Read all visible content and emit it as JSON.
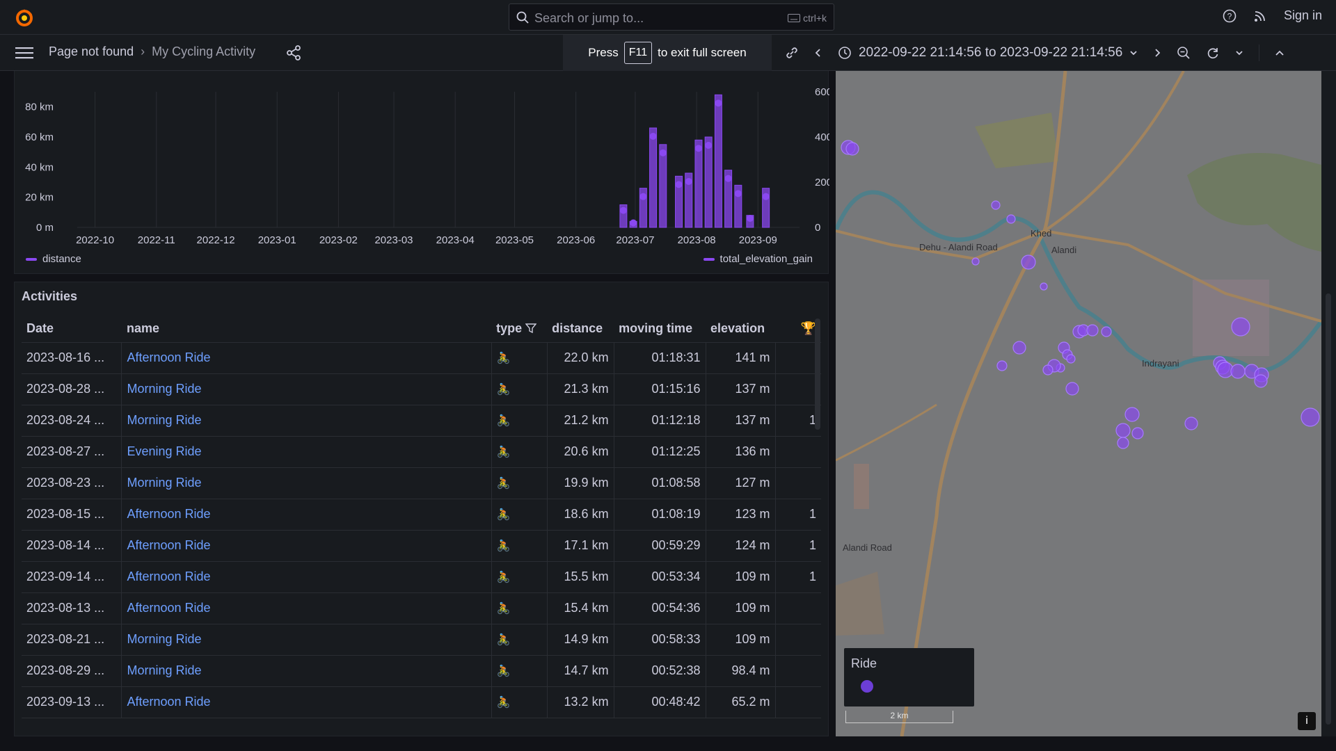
{
  "topbar": {
    "search_placeholder": "Search or jump to...",
    "search_shortcut": "ctrl+k",
    "sign_in": "Sign in"
  },
  "navbar": {
    "breadcrumb": [
      "Page not found",
      "My Cycling Activity"
    ],
    "f11_press": "Press",
    "f11_key": "F11",
    "f11_rest": "to exit full screen",
    "time_range": "2022-09-22 21:14:56 to 2023-09-22 21:14:56"
  },
  "chart_data": {
    "type": "bar",
    "x_ticks": [
      "2022-10",
      "2022-11",
      "2022-12",
      "2023-01",
      "2023-02",
      "2023-03",
      "2023-04",
      "2023-05",
      "2023-06",
      "2023-07",
      "2023-08",
      "2023-09"
    ],
    "y_left_ticks": [
      "0 m",
      "20 km",
      "40 km",
      "60 km",
      "80 km"
    ],
    "y_right_ticks": [
      "0",
      "200",
      "400",
      "600"
    ],
    "ylim_left_km": [
      0,
      90
    ],
    "ylim_right": [
      0,
      600
    ],
    "series": [
      {
        "name": "distance",
        "color": "#8a48f0",
        "dates": [
          "2023-06-25",
          "2023-06-30",
          "2023-07-05",
          "2023-07-10",
          "2023-07-15",
          "2023-07-23",
          "2023-07-28",
          "2023-08-02",
          "2023-08-07",
          "2023-08-12",
          "2023-08-17",
          "2023-08-22",
          "2023-08-28",
          "2023-09-05"
        ],
        "values_km": [
          15,
          4,
          26,
          66,
          55,
          34,
          36,
          58,
          60,
          88,
          38,
          28,
          8,
          26
        ]
      },
      {
        "name": "total_elevation_gain",
        "color": "#8a48f0"
      }
    ],
    "legend_left": "distance",
    "legend_right": "total_elevation_gain"
  },
  "activities": {
    "title": "Activities",
    "columns": [
      "Date",
      "name",
      "type",
      "distance",
      "moving time",
      "elevation",
      ""
    ],
    "rows": [
      {
        "date": "2023-08-16 ...",
        "name": "Afternoon Ride",
        "type": "🚴",
        "distance": "22.0 km",
        "moving": "01:18:31",
        "elev": "141 m",
        "trophy": ""
      },
      {
        "date": "2023-08-28 ...",
        "name": "Morning Ride",
        "type": "🚴",
        "distance": "21.3 km",
        "moving": "01:15:16",
        "elev": "137 m",
        "trophy": ""
      },
      {
        "date": "2023-08-24 ...",
        "name": "Morning Ride",
        "type": "🚴",
        "distance": "21.2 km",
        "moving": "01:12:18",
        "elev": "137 m",
        "trophy": "1"
      },
      {
        "date": "2023-08-27 ...",
        "name": "Evening Ride",
        "type": "🚴",
        "distance": "20.6 km",
        "moving": "01:12:25",
        "elev": "136 m",
        "trophy": ""
      },
      {
        "date": "2023-08-23 ...",
        "name": "Morning Ride",
        "type": "🚴",
        "distance": "19.9 km",
        "moving": "01:08:58",
        "elev": "127 m",
        "trophy": ""
      },
      {
        "date": "2023-08-15 ...",
        "name": "Afternoon Ride",
        "type": "🚴",
        "distance": "18.6 km",
        "moving": "01:08:19",
        "elev": "123 m",
        "trophy": "1"
      },
      {
        "date": "2023-08-14 ...",
        "name": "Afternoon Ride",
        "type": "🚴",
        "distance": "17.1 km",
        "moving": "00:59:29",
        "elev": "124 m",
        "trophy": "1"
      },
      {
        "date": "2023-09-14 ...",
        "name": "Afternoon Ride",
        "type": "🚴",
        "distance": "15.5 km",
        "moving": "00:53:34",
        "elev": "109 m",
        "trophy": "1"
      },
      {
        "date": "2023-08-13 ...",
        "name": "Afternoon Ride",
        "type": "🚴",
        "distance": "15.4 km",
        "moving": "00:54:36",
        "elev": "109 m",
        "trophy": ""
      },
      {
        "date": "2023-08-21 ...",
        "name": "Morning Ride",
        "type": "🚴",
        "distance": "14.9 km",
        "moving": "00:58:33",
        "elev": "109 m",
        "trophy": ""
      },
      {
        "date": "2023-08-29 ...",
        "name": "Morning Ride",
        "type": "🚴",
        "distance": "14.7 km",
        "moving": "00:52:38",
        "elev": "98.4 m",
        "trophy": ""
      },
      {
        "date": "2023-09-13 ...",
        "name": "Afternoon Ride",
        "type": "🚴",
        "distance": "13.2 km",
        "moving": "00:48:42",
        "elev": "65.2 m",
        "trophy": ""
      }
    ]
  },
  "map": {
    "legend_title": "Ride",
    "scale": "2 km",
    "info": "i",
    "places": [
      "Alandi",
      "Dehu - Alandi Road",
      "Indrayani",
      "Alandi Road",
      "Khed"
    ],
    "marker_color": "#8a48f0"
  }
}
